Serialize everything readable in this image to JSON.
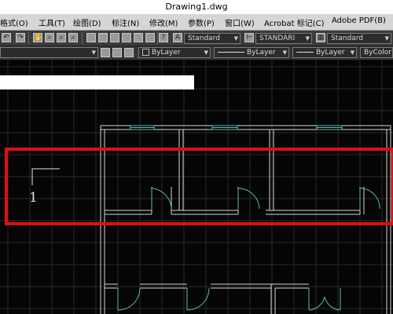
{
  "window": {
    "title": "Drawing1.dwg"
  },
  "menus": [
    {
      "label": "格式(O)"
    },
    {
      "label": "工具(T)"
    },
    {
      "label": "绘图(D)"
    },
    {
      "label": "标注(N)"
    },
    {
      "label": "修改(M)"
    },
    {
      "label": "参数(P)"
    },
    {
      "label": "窗口(W)"
    },
    {
      "label": "Acrobat 标记(C)"
    },
    {
      "label": "Adobe PDF(B)"
    }
  ],
  "toolbar": {
    "text_style": "Standard",
    "dim_style": "STANDARI",
    "table_style": "Standard"
  },
  "properties": {
    "layer_color": "ByLayer",
    "linetype": "ByLayer",
    "lineweight": "ByLayer",
    "plot_style": "ByColor"
  },
  "command_line": {
    "value": ""
  },
  "drawing": {
    "annotation_text": "1",
    "highlight_color": "#e01010",
    "wall_color": "#d8d8d8",
    "window_color": "#5fb7b7",
    "grid_color": "#2a2a2a"
  }
}
